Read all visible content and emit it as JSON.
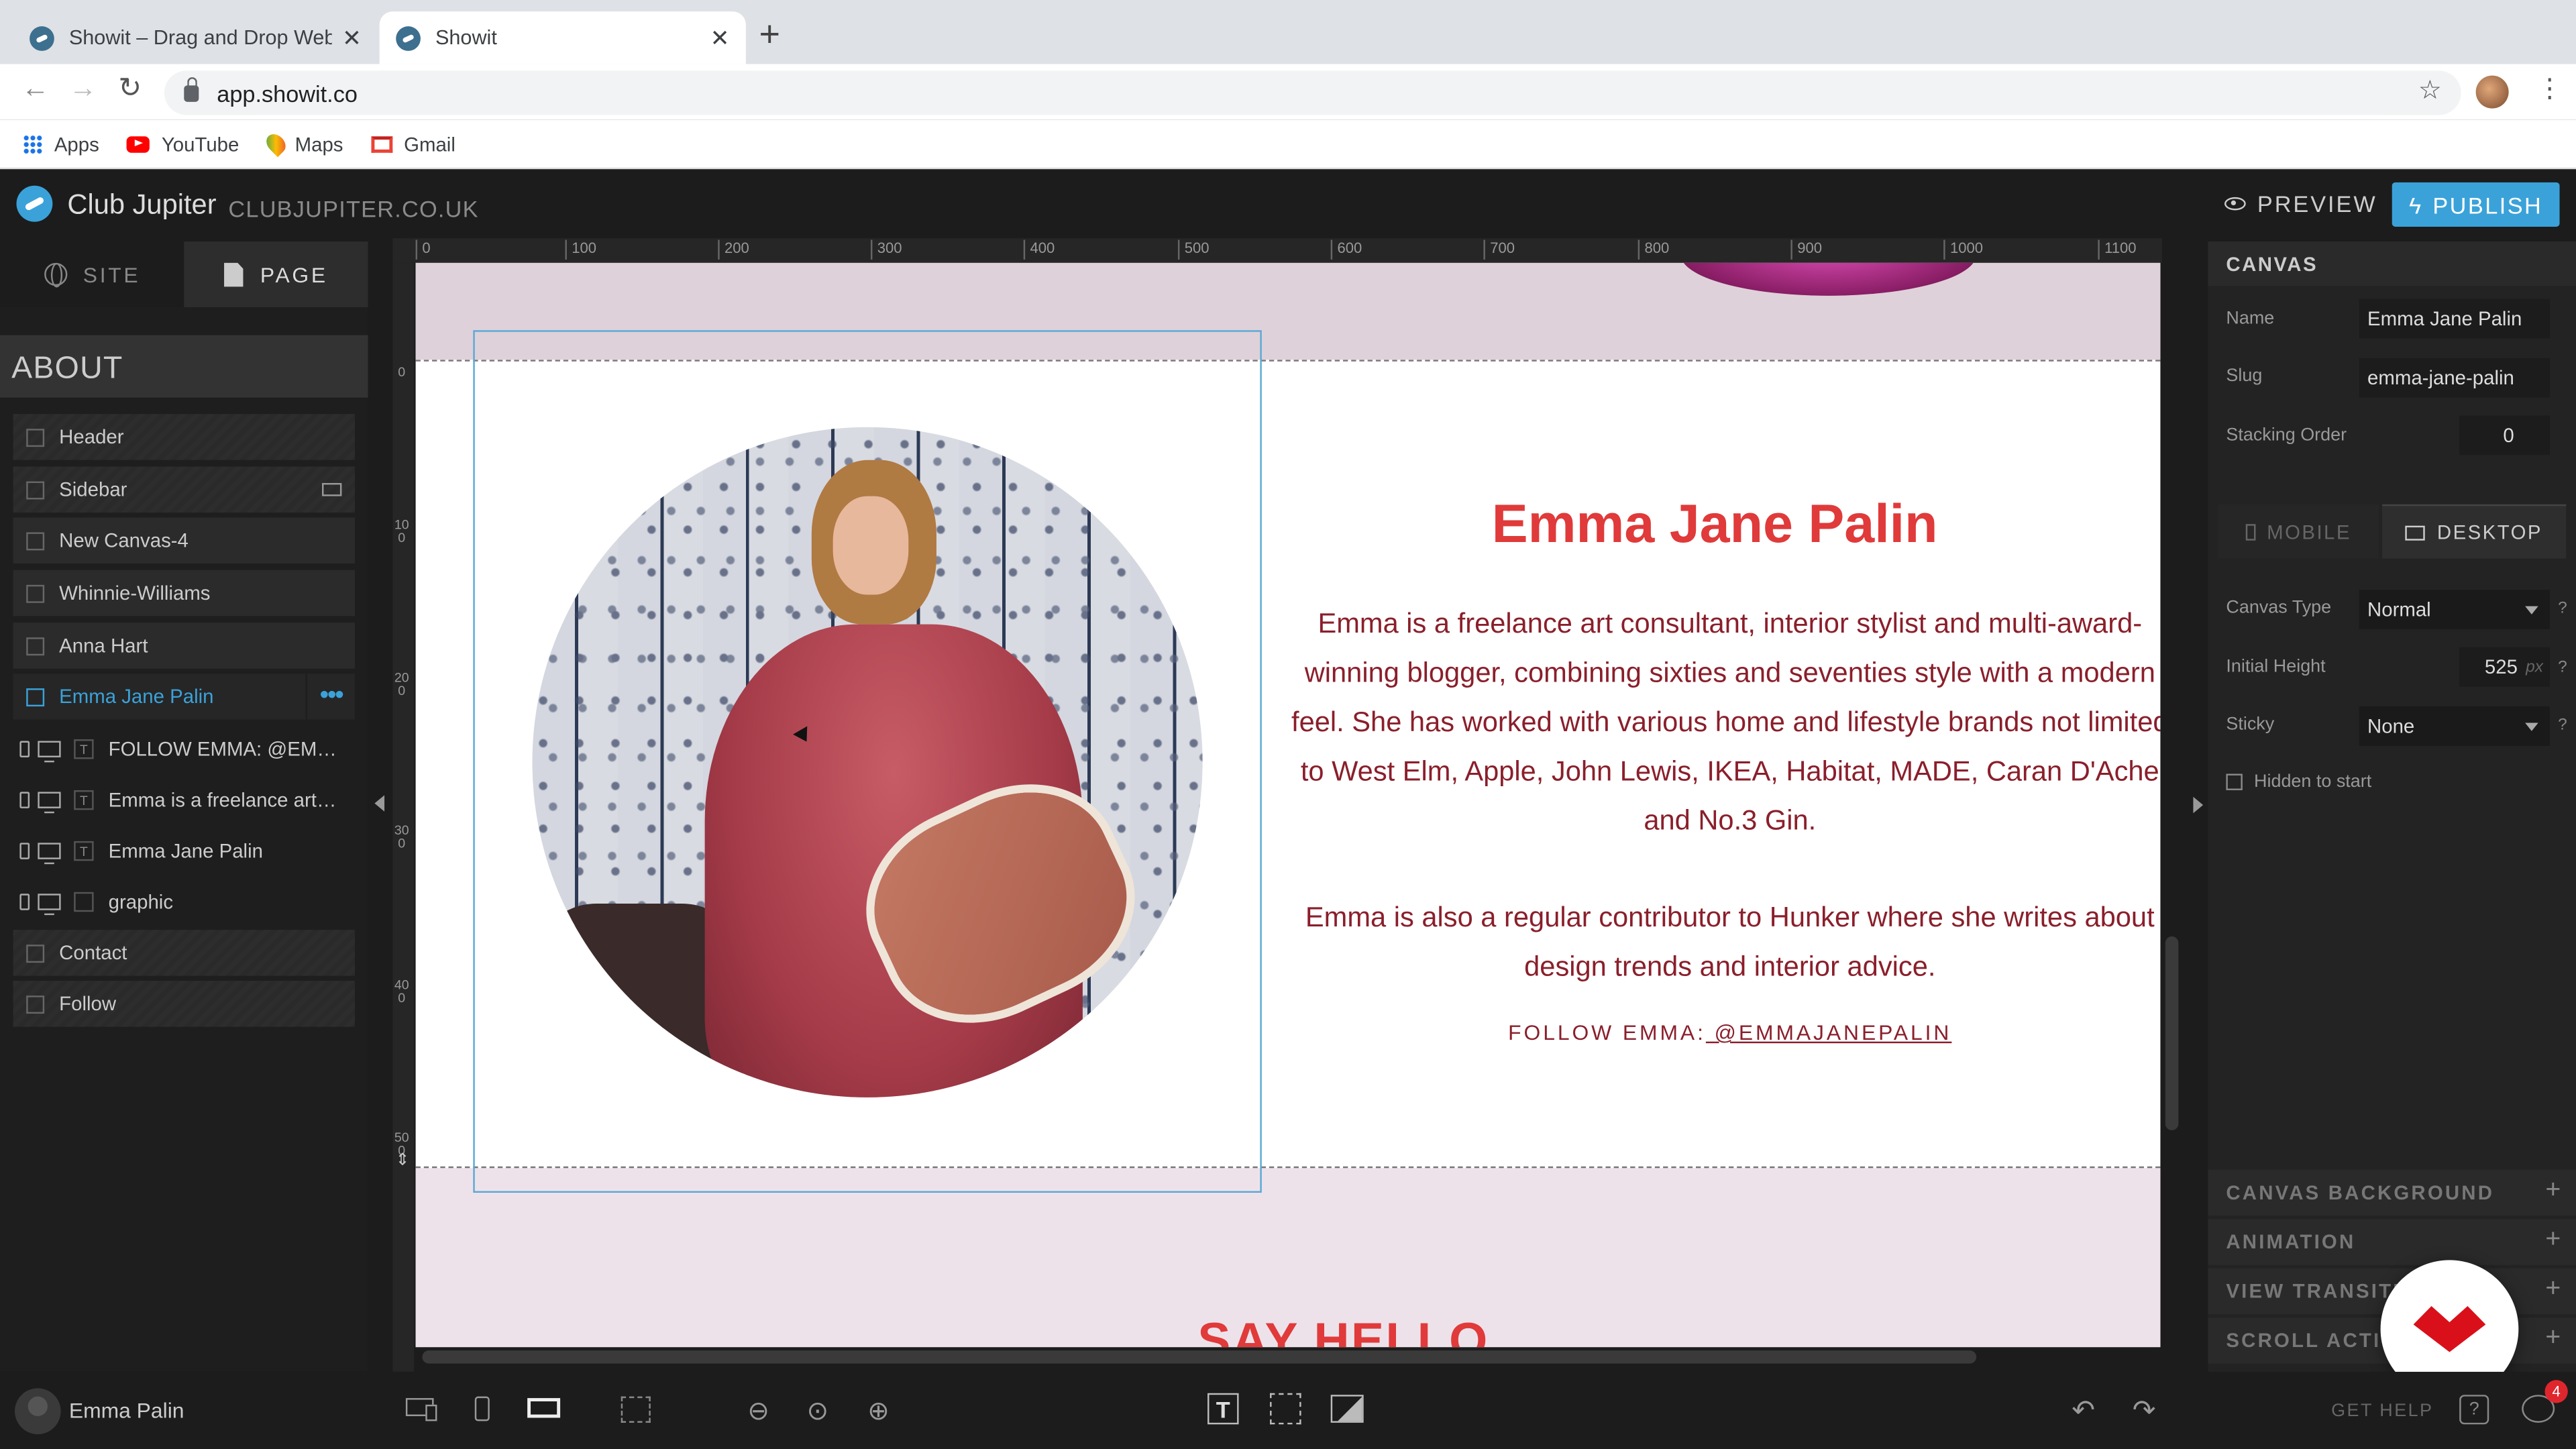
{
  "browser": {
    "tabs": [
      {
        "title": "Showit – Drag and Drop Websit",
        "close": "✕"
      },
      {
        "title": "Showit",
        "close": "✕"
      }
    ],
    "new_tab": "+",
    "url": "app.showit.co",
    "bookmarks": [
      {
        "label": "Apps",
        "icon": "apps-grid-icon"
      },
      {
        "label": "YouTube",
        "icon": "youtube-icon"
      },
      {
        "label": "Maps",
        "icon": "maps-icon"
      },
      {
        "label": "Gmail",
        "icon": "gmail-icon"
      }
    ]
  },
  "app": {
    "site_name": "Club Jupiter",
    "site_domain": "CLUBJUPITER.CO.UK",
    "preview_label": "PREVIEW",
    "publish_label": "PUBLISH",
    "accent": "#3aa2d9"
  },
  "left_panel": {
    "tabs": [
      "SITE",
      "PAGE"
    ],
    "page_title": "ABOUT",
    "canvases": [
      {
        "label": "Header",
        "style": "striped"
      },
      {
        "label": "Sidebar",
        "style": "striped"
      },
      {
        "label": "New Canvas-4",
        "style": "solid"
      },
      {
        "label": "Whinnie-Williams",
        "style": "solid"
      },
      {
        "label": "Anna Hart",
        "style": "solid"
      },
      {
        "label": "Emma Jane Palin",
        "style": "selected",
        "more": "•••"
      }
    ],
    "layers": [
      {
        "label": "FOLLOW EMMA: @EMMA...",
        "type": "T"
      },
      {
        "label": "Emma is a freelance art con...",
        "type": "T"
      },
      {
        "label": "Emma Jane Palin",
        "type": "T"
      },
      {
        "label": "graphic",
        "type": ""
      }
    ],
    "canvases_after": [
      "Contact",
      "Follow"
    ]
  },
  "rulers": {
    "top": [
      "0",
      "100",
      "200",
      "300",
      "400",
      "500",
      "600",
      "700",
      "800",
      "900",
      "1000",
      "1100"
    ],
    "left": [
      "0",
      "100",
      "200",
      "300",
      "400",
      "500"
    ]
  },
  "canvas": {
    "headline": "Emma Jane Palin",
    "para1": "Emma is a freelance art consultant, interior stylist and multi-award-winning blogger, combining sixties and seventies style with a modern feel. She has worked with various home and lifestyle brands not limited to West Elm, Apple, John Lewis, IKEA, Habitat, MADE, Caran D'Ache and No.3 Gin.",
    "para2": "Emma is also a regular contributor to Hunker where she writes about design trends and interior advice.",
    "follow_prefix": "FOLLOW EMMA:",
    "follow_handle": " @EMMAJANEPALIN",
    "next_section_heading": "SAY HELLO",
    "heading_color": "#e03a3a",
    "text_color": "#8a1f2b"
  },
  "right_panel": {
    "section_title": "CANVAS",
    "name_label": "Name",
    "name_value": "Emma Jane Palin",
    "slug_label": "Slug",
    "slug_value": "emma-jane-palin",
    "stacking_label": "Stacking Order",
    "stacking_value": "0",
    "mobile_tab": "MOBILE",
    "desktop_tab": "DESKTOP",
    "canvas_type_label": "Canvas Type",
    "canvas_type_value": "Normal",
    "initial_height_label": "Initial Height",
    "initial_height_value": "525",
    "initial_height_unit": "px",
    "sticky_label": "Sticky",
    "sticky_value": "None",
    "hidden_label": "Hidden to start",
    "help_mark": "?",
    "accordions": [
      "CANVAS BACKGROUND",
      "ANIMATION",
      "VIEW TRANSITIO",
      "SCROLL ACTIO"
    ],
    "accordion_plus": "+"
  },
  "bottom_bar": {
    "user_name": "Emma Palin",
    "get_help": "GET HELP",
    "help_q": "?",
    "chat_badge": "4",
    "text_tool": "T"
  }
}
